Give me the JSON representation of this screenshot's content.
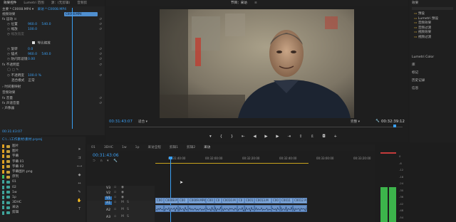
{
  "effects_panel": {
    "tabs": [
      "效果控件",
      "Lumetri 范围",
      "源：(无剪辑)",
      "音频剪"
    ],
    "header_source": "主要 * C0008.MP4",
    "header_sequence": "采访 * C0008.MP4",
    "clip_name": "C0008.MP4",
    "section_video": "视频效果",
    "motion": "fx 运动",
    "position_label": "位置",
    "position_x": "960.0",
    "position_y": "540.0",
    "scale_label": "缩放",
    "scale_value": "100.0",
    "scale_width_label": "缩放宽度",
    "uniform_scale_label": "等比缩放",
    "rotation_label": "旋转",
    "rotation_value": "0.0",
    "anchor_label": "锚点",
    "anchor_x": "960.0",
    "anchor_y": "540.0",
    "antiflicker_label": "防闪烁滤镜",
    "antiflicker_value": "0.00",
    "opacity": "fx 不透明度",
    "opacity_label": "不透明度",
    "opacity_value": "100.0 %",
    "blend_label": "混合模式",
    "blend_value": "正常",
    "time_remap": "时间重映射",
    "section_audio": "音频效果",
    "volume": "fx 音量",
    "channel_volume": "fx 声道音量",
    "panner": "声像器",
    "timecode": "00:31:43:07"
  },
  "program_monitor": {
    "title": "节目：采访",
    "timecode_left": "00:31:43:07",
    "fit_label": "适合",
    "quality_label": "完整",
    "timecode_right": "00:32:39:12"
  },
  "effects_browser": {
    "title": "效果",
    "items": [
      "预设",
      "Lumetri 预设",
      "音频效果",
      "音频过渡",
      "视频效果",
      "视频过渡"
    ],
    "side_items": [
      "Lumetri Color",
      "库",
      "标记",
      "历史记录",
      "信息"
    ]
  },
  "project_panel": {
    "path": "C:\\...\\工作素材\\素材.prproj",
    "items": [
      {
        "name": "图片",
        "color": "#e0a020"
      },
      {
        "name": "图片",
        "color": "#e0a020"
      },
      {
        "name": "字幕",
        "color": "#e0a020"
      },
      {
        "name": "字幕 01",
        "color": "#e0a020"
      },
      {
        "name": "字幕 02",
        "color": "#e0a020"
      },
      {
        "name": "字幕图片.png",
        "color": "#e0a020"
      },
      {
        "name": "序列",
        "color": "#3fbf5f"
      },
      {
        "name": "01",
        "color": "#3fa39a"
      },
      {
        "name": "02",
        "color": "#3fa39a"
      },
      {
        "name": "1w",
        "color": "#3fa39a"
      },
      {
        "name": "1p",
        "color": "#3fa39a"
      },
      {
        "name": "3DHC",
        "color": "#3fa39a"
      },
      {
        "name": "采访",
        "color": "#3fa39a"
      },
      {
        "name": "剪辑",
        "color": "#3fa39a"
      }
    ]
  },
  "timeline": {
    "tabs": [
      "01",
      "3DHC",
      "1w",
      "1p",
      "采访全程",
      "剪辑1",
      "剪辑2",
      "采访"
    ],
    "timecode": "00:31:43:06",
    "ruler": [
      "00:31:40:00",
      "00:32:00:00",
      "00:32:20:00",
      "00:32:40:00",
      "00:33:00:00",
      "00:33:20:00"
    ],
    "tracks": [
      "V3",
      "V2",
      "V1",
      "A1",
      "A2",
      "A3"
    ],
    "clips": [
      "C00",
      "C0008.M",
      "C00",
      "C0009.MP4",
      "C00",
      "C0",
      "C0010.M",
      "C0",
      "C001",
      "C0013.M",
      "C00",
      "C0011",
      "C0012.M"
    ]
  },
  "meters": {
    "scale": [
      "0",
      "-6",
      "-12",
      "-18",
      "-24",
      "-30",
      "-36",
      "-42",
      "-48",
      "-54"
    ]
  },
  "colors": {
    "accent": "#3a9ff3",
    "clip_video": "#7fa7d8",
    "clip_audio": "#6b93c9",
    "meter_green": "#3cb44b"
  }
}
